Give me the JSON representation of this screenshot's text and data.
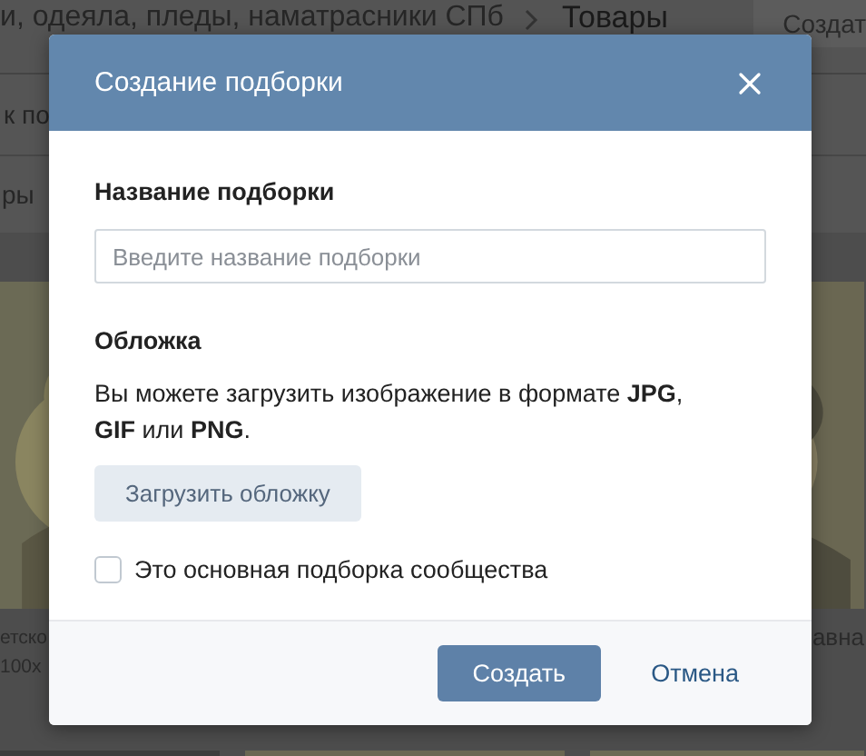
{
  "page": {
    "breadcrumb": "и, одеяла, пледы, наматрасники СПб",
    "current": "Товары",
    "create_button": "Создат",
    "search_placeholder": "к по",
    "tab": "ры",
    "products": [
      {
        "kind": "picture",
        "title": "етско",
        "subtitle": "100х"
      },
      {
        "kind": "covered"
      },
      {
        "kind": "picture",
        "title": "авна"
      }
    ]
  },
  "modal": {
    "title": "Создание подборки",
    "name_label": "Название подборки",
    "name_placeholder": "Введите название подборки",
    "cover_label": "Обложка",
    "cover_text": "Вы можете загрузить изображение в формате **JPG**, **GIF** или **PNG**.",
    "upload_button": "Загрузить обложку",
    "checkbox": {
      "label": "Это основная подборка сообщества",
      "checked": false
    },
    "buttons": [
      {
        "label": "Создать",
        "kind": "primary"
      },
      {
        "label": "Отмена",
        "kind": "link"
      }
    ]
  }
}
